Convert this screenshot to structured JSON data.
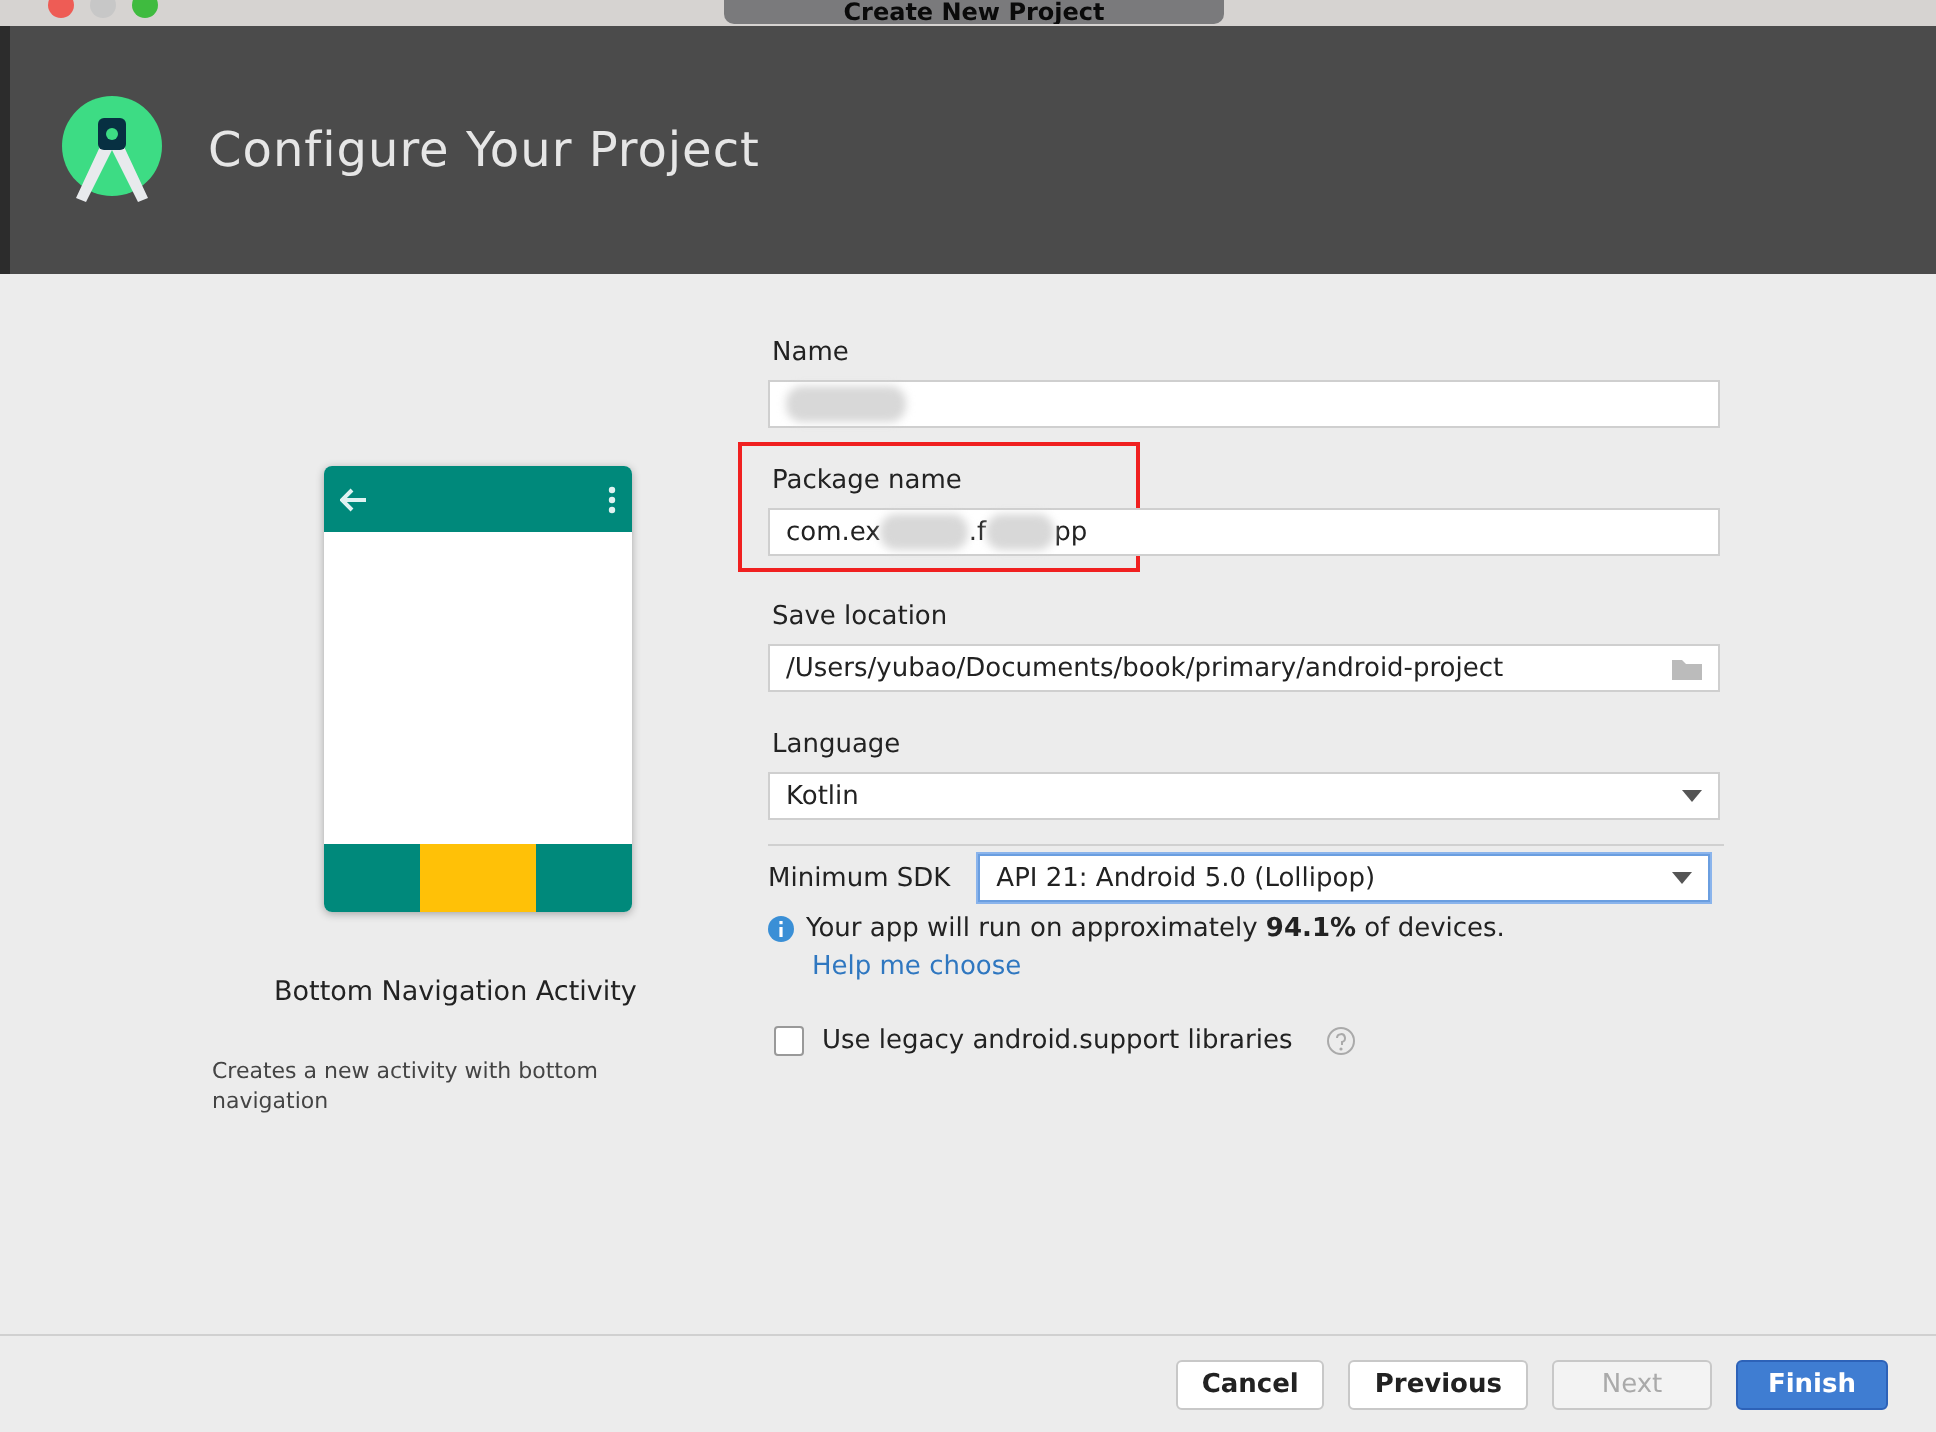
{
  "window": {
    "title": "Create New Project"
  },
  "header": {
    "title": "Configure Your Project"
  },
  "template": {
    "name": "Bottom Navigation Activity",
    "description": "Creates a new activity with bottom navigation"
  },
  "fields": [
    {
      "kind": "text",
      "label": "Name",
      "redacted": true,
      "highlighted": false
    },
    {
      "kind": "text",
      "label": "Package name",
      "value_parts": [
        "com.ex",
        ".f",
        "pp"
      ],
      "redacted": true,
      "highlighted": true
    },
    {
      "kind": "folder",
      "label": "Save location",
      "value": "/Users/yubao/Documents/book/primary/android-project",
      "highlighted": false
    },
    {
      "kind": "select",
      "label": "Language",
      "value": "Kotlin",
      "highlighted": false
    }
  ],
  "min_sdk": {
    "label": "Minimum SDK",
    "value": "API 21: Android 5.0 (Lollipop)",
    "focused": true
  },
  "info": {
    "text": "Your app will run on approximately **94.1%** of devices.",
    "link": "Help me choose"
  },
  "legacy": {
    "label": "Use legacy android.support libraries",
    "checked": false
  },
  "buttons": [
    {
      "label": "Cancel",
      "disabled": false,
      "primary": false
    },
    {
      "label": "Previous",
      "disabled": false,
      "primary": false
    },
    {
      "label": "Next",
      "disabled": true,
      "primary": false
    },
    {
      "label": "Finish",
      "disabled": false,
      "primary": true
    }
  ]
}
